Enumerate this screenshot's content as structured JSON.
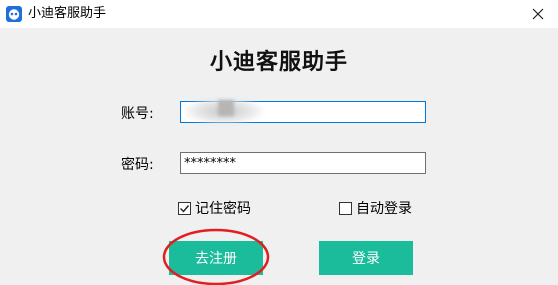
{
  "window": {
    "title": "小迪客服助手",
    "close_glyph": "✕"
  },
  "main": {
    "heading": "小迪客服助手"
  },
  "form": {
    "account_label": "账号:",
    "account_value": "",
    "password_label": "密码:",
    "password_value": "********",
    "remember_label": "记住密码",
    "remember_checked": true,
    "auto_login_label": "自动登录",
    "auto_login_checked": false
  },
  "buttons": {
    "register_label": "去注册",
    "login_label": "登录"
  },
  "colors": {
    "accent": "#1abc9c",
    "focus_border": "#0078d7",
    "annotation": "#e02020"
  },
  "icons": {
    "app": "app-logo-icon",
    "close": "close-icon",
    "check": "check-icon"
  }
}
